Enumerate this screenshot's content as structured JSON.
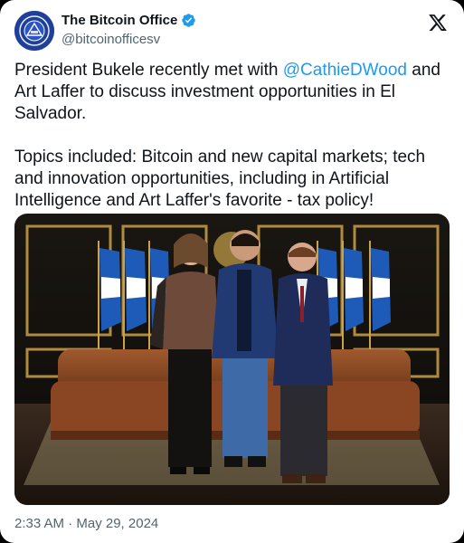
{
  "author": {
    "display_name": "The Bitcoin Office",
    "handle": "@bitcoinofficesv",
    "verified": true,
    "avatar_icon": "el-salvador-seal-icon"
  },
  "platform_logo": "x-logo-icon",
  "tweet": {
    "line1_before": "President Bukele recently met with ",
    "mention": "@CathieDWood",
    "line1_after": " and Art Laffer to discuss investment opportunities in El Salvador.",
    "paragraph2": "Topics included: Bitcoin and new capital markets; tech and innovation opportunities, including in Artificial Intelligence and Art Laffer's favorite - tax policy!"
  },
  "media": {
    "type": "photo",
    "subject": "three-people-standing-in-office-with-flags"
  },
  "meta": {
    "timestamp": "2:33 AM · May 29, 2024"
  },
  "colors": {
    "link": "#1d9bf0",
    "verified": "#1d9bf0",
    "secondary_text": "#536471"
  }
}
